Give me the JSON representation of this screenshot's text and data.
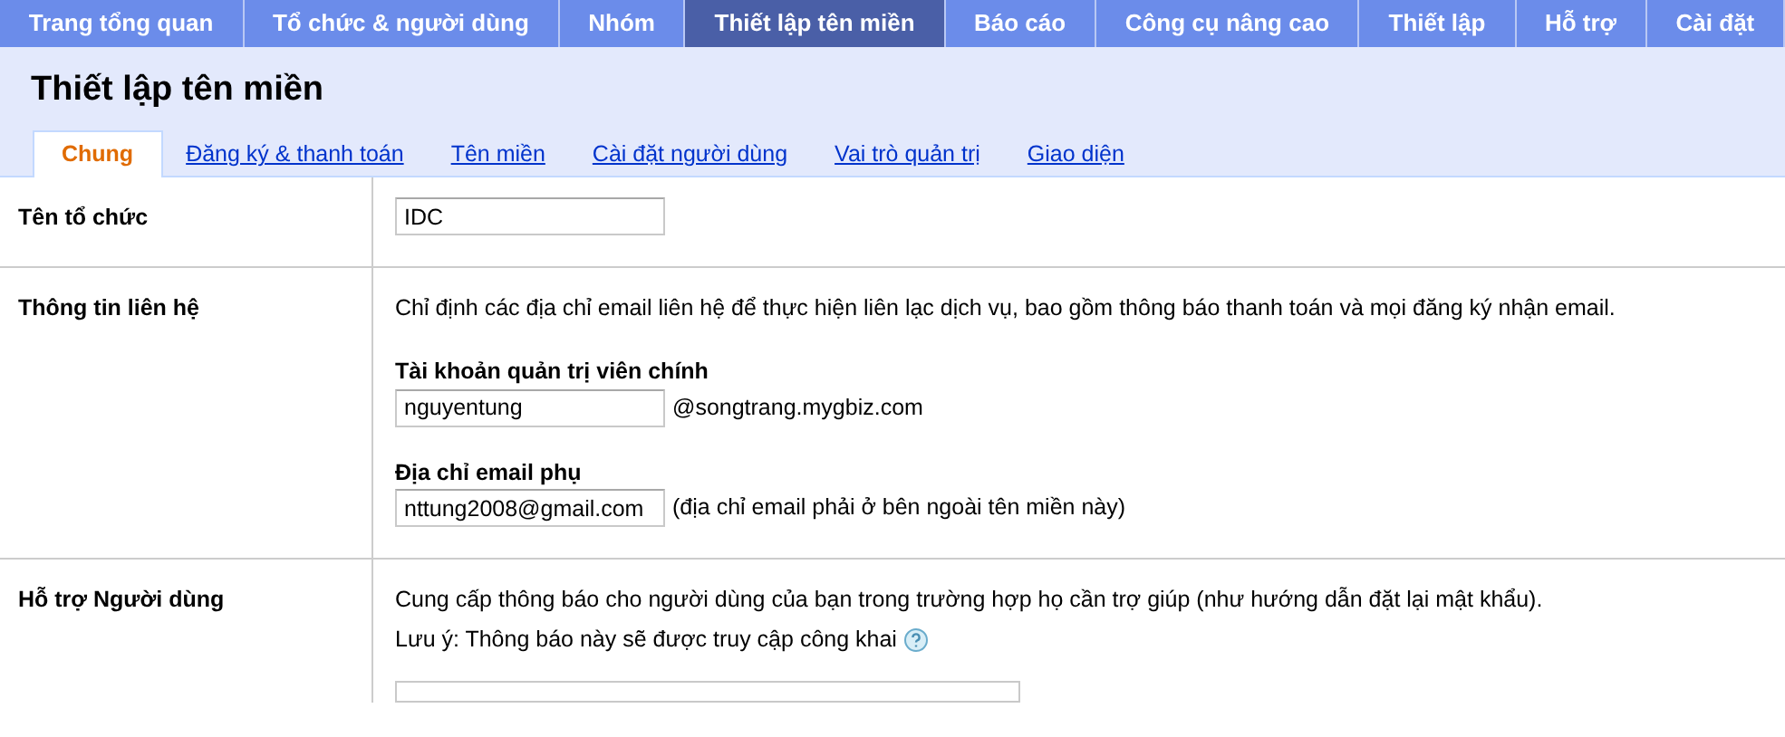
{
  "top_nav": [
    {
      "label": "Trang tổng quan",
      "selected": false
    },
    {
      "label": "Tổ chức & người dùng",
      "selected": false
    },
    {
      "label": "Nhóm",
      "selected": false
    },
    {
      "label": "Thiết lập tên miền",
      "selected": true
    },
    {
      "label": "Báo cáo",
      "selected": false
    },
    {
      "label": "Công cụ nâng cao",
      "selected": false
    },
    {
      "label": "Thiết lập",
      "selected": false
    },
    {
      "label": "Hỗ trợ",
      "selected": false
    },
    {
      "label": "Cài đặt",
      "selected": false
    }
  ],
  "page_title": "Thiết lập tên miền",
  "tabs": [
    {
      "label": "Chung",
      "selected": true
    },
    {
      "label": "Đăng ký & thanh toán",
      "selected": false
    },
    {
      "label": "Tên miền",
      "selected": false
    },
    {
      "label": "Cài đặt người dùng",
      "selected": false
    },
    {
      "label": "Vai trò quản trị",
      "selected": false
    },
    {
      "label": "Giao diện",
      "selected": false
    }
  ],
  "sections": [
    {
      "label": "Tên tổ chức",
      "items": [
        {
          "kind": "field",
          "value": "IDC"
        }
      ]
    },
    {
      "label": "Thông tin liên hệ",
      "items": [
        {
          "kind": "text",
          "text": "Chỉ định các địa chỉ email liên hệ để thực hiện liên lạc dịch vụ, bao gồm thông báo thanh toán và mọi đăng ký nhận email."
        },
        {
          "kind": "heading",
          "text": "Tài khoản quản trị viên chính"
        },
        {
          "kind": "field",
          "value": "nguyentung",
          "suffix": "@songtrang.mygbiz.com"
        },
        {
          "kind": "heading",
          "text": "Địa chỉ email phụ"
        },
        {
          "kind": "field",
          "value": "nttung2008@gmail.com",
          "suffix": "(địa chỉ email phải ở bên ngoài tên miền này)"
        }
      ]
    },
    {
      "label": "Hỗ trợ Người dùng",
      "items": [
        {
          "kind": "text",
          "text": "Cung cấp thông báo cho người dùng của bạn trong trường hợp họ cần trợ giúp (như hướng dẫn đặt lại mật khẩu)."
        },
        {
          "kind": "note",
          "text": "Lưu ý: Thông báo này sẽ được truy cập công khai"
        },
        {
          "kind": "area"
        }
      ]
    }
  ]
}
